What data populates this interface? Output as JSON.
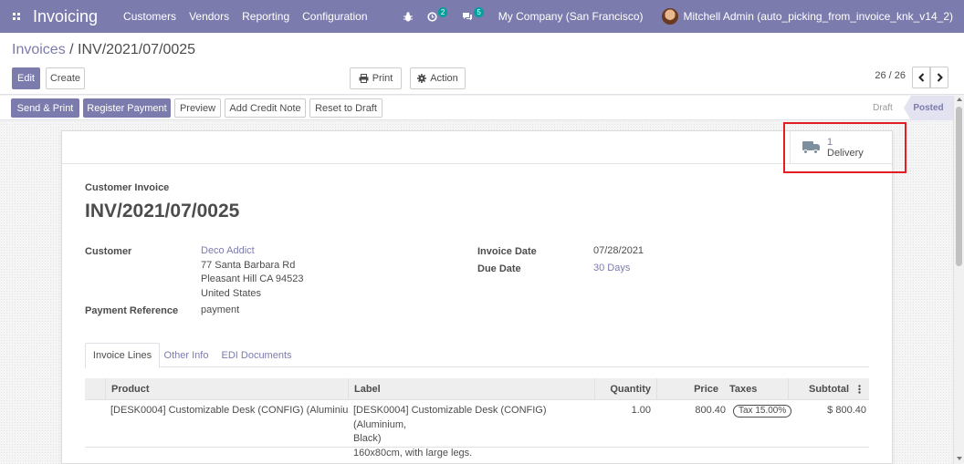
{
  "navbar": {
    "app_name": "Invoicing",
    "menu": [
      "Customers",
      "Vendors",
      "Reporting",
      "Configuration"
    ],
    "activity_badge": "2",
    "messages_badge": "5",
    "company": "My Company (San Francisco)",
    "user": "Mitchell Admin (auto_picking_from_invoice_knk_v14_2)"
  },
  "breadcrumb": {
    "parent": "Invoices",
    "separator": " / ",
    "current": "INV/2021/07/0025"
  },
  "control": {
    "edit_label": "Edit",
    "create_label": "Create",
    "print_label": "Print",
    "action_label": "Action",
    "pager": "26 / 26"
  },
  "statusbar": {
    "buttons": [
      "Send & Print",
      "Register Payment",
      "Preview",
      "Add Credit Note",
      "Reset to Draft"
    ],
    "stages": [
      "Draft",
      "Posted"
    ],
    "active_stage": "Posted"
  },
  "smart_button": {
    "count": "1",
    "label": "Delivery"
  },
  "invoice": {
    "type": "Customer Invoice",
    "name": "INV/2021/07/0025",
    "customer_label": "Customer",
    "customer_name": "Deco Addict",
    "address": [
      "77 Santa Barbara Rd",
      "Pleasant Hill CA 94523",
      "United States"
    ],
    "payment_ref_label": "Payment Reference",
    "payment_ref": "payment",
    "invoice_date_label": "Invoice Date",
    "invoice_date": "07/28/2021",
    "due_date_label": "Due Date",
    "due_date": "30 Days"
  },
  "tabs": [
    "Invoice Lines",
    "Other Info",
    "EDI Documents"
  ],
  "lines": {
    "headers": {
      "product": "Product",
      "label": "Label",
      "quantity": "Quantity",
      "price": "Price",
      "taxes": "Taxes",
      "subtotal": "Subtotal"
    },
    "rows": [
      {
        "product": "[DESK0004] Customizable Desk (CONFIG) (Aluminiu…",
        "label_line1": "[DESK0004] Customizable Desk (CONFIG) (Aluminium,",
        "label_line2": "Black)",
        "label_line3": "160x80cm, with large legs.",
        "quantity": "1.00",
        "price": "800.40",
        "tax": "Tax 15.00%",
        "subtotal": "$ 800.40"
      }
    ]
  },
  "colors": {
    "brand": "#7c7bad",
    "highlight": "#e21d23",
    "badge": "#00a09d"
  }
}
